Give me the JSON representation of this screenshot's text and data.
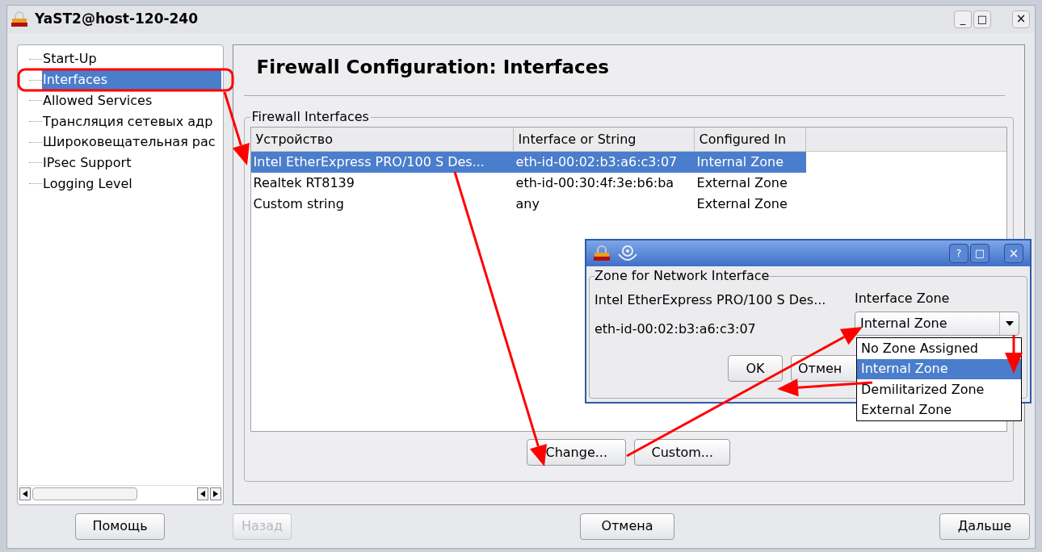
{
  "window": {
    "title": "YaST2@host-120-240",
    "controls": [
      "_",
      "□",
      "×"
    ]
  },
  "sidebar": {
    "items": [
      {
        "label": "Start-Up",
        "selected": false
      },
      {
        "label": "Interfaces",
        "selected": true
      },
      {
        "label": "Allowed Services",
        "selected": false
      },
      {
        "label": "Трансляция сетевых адр",
        "selected": false
      },
      {
        "label": "Широковещательная рас",
        "selected": false
      },
      {
        "label": "IPsec Support",
        "selected": false
      },
      {
        "label": "Logging Level",
        "selected": false
      }
    ]
  },
  "main": {
    "title": "Firewall Configuration: Interfaces",
    "group": {
      "legend": "Firewall Interfaces",
      "table": {
        "columns": [
          "Устройство",
          "Interface or String",
          "Configured In"
        ],
        "rows": [
          {
            "cells": [
              "Intel EtherExpress PRO/100 S Des...",
              "eth-id-00:02:b3:a6:c3:07",
              "Internal Zone"
            ],
            "selected": true
          },
          {
            "cells": [
              "Realtek RT8139",
              "eth-id-00:30:4f:3e:b6:ba",
              "External Zone"
            ],
            "selected": false
          },
          {
            "cells": [
              "Custom string",
              "any",
              "External Zone"
            ],
            "selected": false
          }
        ]
      },
      "buttons": [
        "Change...",
        "Custom..."
      ]
    }
  },
  "dialog": {
    "controls": [
      "?",
      "□",
      "×"
    ],
    "legend": "Zone for Network Interface",
    "device": "Intel EtherExpress PRO/100 S Des...",
    "interface": "eth-id-00:02:b3:a6:c3:07",
    "zone_label": "Interface Zone",
    "zone_value": "Internal Zone",
    "options": [
      {
        "label": "No Zone Assigned",
        "selected": false
      },
      {
        "label": "Internal Zone",
        "selected": true
      },
      {
        "label": "Demilitarized Zone",
        "selected": false
      },
      {
        "label": "External Zone",
        "selected": false
      }
    ],
    "buttons": [
      "OK",
      "Отмен"
    ]
  },
  "footer": {
    "buttons": [
      {
        "label": "Помощь",
        "disabled": false
      },
      {
        "label": "Назад",
        "disabled": true
      },
      {
        "label": "Отмена",
        "disabled": false
      },
      {
        "label": "Дальше",
        "disabled": false
      }
    ]
  }
}
